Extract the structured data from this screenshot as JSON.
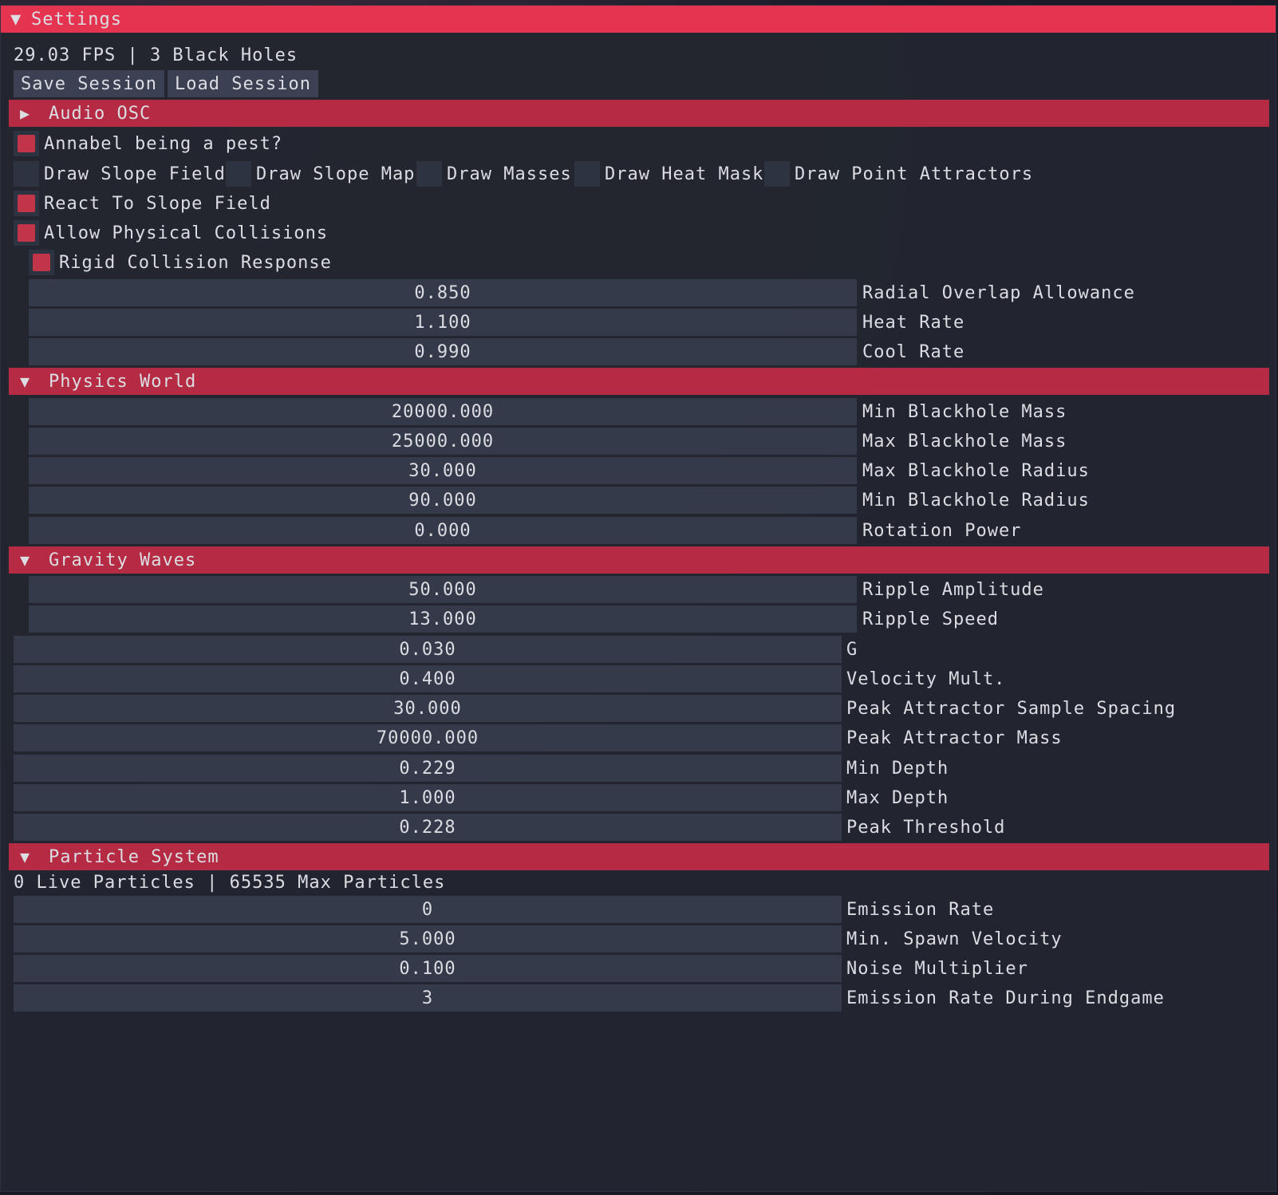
{
  "window": {
    "title": "Settings",
    "collapse_icon": "triangle-down"
  },
  "status": {
    "text": "29.03 FPS | 3 Black Holes"
  },
  "buttons": {
    "save": "Save Session",
    "load": "Load Session"
  },
  "sections": {
    "audio": {
      "label": "Audio OSC",
      "icon": "triangle-right"
    },
    "physics": {
      "label": "Physics World",
      "icon": "triangle-down"
    },
    "gravity": {
      "label": "Gravity Waves",
      "icon": "triangle-down"
    },
    "particles": {
      "label": "Particle System",
      "icon": "triangle-down"
    }
  },
  "checkboxes": {
    "annabel": {
      "label": "Annabel being a pest?",
      "checked": true
    },
    "slope_field": {
      "label": "Draw Slope Field",
      "checked": false
    },
    "slope_map": {
      "label": "Draw Slope Map",
      "checked": false
    },
    "masses": {
      "label": "Draw Masses",
      "checked": false
    },
    "heat_mask": {
      "label": "Draw Heat Mask",
      "checked": false
    },
    "point_attractors": {
      "label": "Draw Point Attractors",
      "checked": false
    },
    "react_slope": {
      "label": "React To Slope Field",
      "checked": true
    },
    "collisions": {
      "label": "Allow Physical Collisions",
      "checked": true
    },
    "rigid": {
      "label": "Rigid Collision Response",
      "checked": true
    }
  },
  "sliders": {
    "radial_overlap": {
      "value": "0.850",
      "label": "Radial Overlap Allowance"
    },
    "heat_rate": {
      "value": "1.100",
      "label": "Heat Rate"
    },
    "cool_rate": {
      "value": "0.990",
      "label": "Cool Rate"
    },
    "min_bh_mass": {
      "value": "20000.000",
      "label": "Min Blackhole Mass"
    },
    "max_bh_mass": {
      "value": "25000.000",
      "label": "Max Blackhole Mass"
    },
    "max_bh_radius": {
      "value": "30.000",
      "label": "Max Blackhole Radius"
    },
    "min_bh_radius": {
      "value": "90.000",
      "label": "Min Blackhole Radius"
    },
    "rotation_power": {
      "value": "0.000",
      "label": "Rotation Power"
    },
    "ripple_amp": {
      "value": "50.000",
      "label": "Ripple Amplitude"
    },
    "ripple_speed": {
      "value": "13.000",
      "label": "Ripple Speed"
    },
    "g": {
      "value": "0.030",
      "label": "G"
    },
    "velocity_mult": {
      "value": "0.400",
      "label": "Velocity Mult."
    },
    "peak_spacing": {
      "value": "30.000",
      "label": "Peak Attractor Sample Spacing"
    },
    "peak_mass": {
      "value": "70000.000",
      "label": "Peak Attractor Mass"
    },
    "min_depth": {
      "value": "0.229",
      "label": "Min Depth"
    },
    "max_depth": {
      "value": "1.000",
      "label": "Max Depth"
    },
    "peak_threshold": {
      "value": "0.228",
      "label": "Peak Threshold"
    },
    "emission_rate": {
      "value": "0",
      "label": "Emission Rate"
    },
    "min_spawn_vel": {
      "value": "5.000",
      "label": "Min. Spawn Velocity"
    },
    "noise_mult": {
      "value": "0.100",
      "label": "Noise Multiplier"
    },
    "emission_endgame": {
      "value": "3",
      "label": "Emission Rate During Endgame"
    }
  },
  "particles": {
    "status": "0 Live Particles | 65535 Max Particles"
  },
  "colors": {
    "title_bar": "#e43450",
    "header": "#b52b44",
    "check": "#c23447",
    "frame": "#343a4a",
    "window_bg": "#232630"
  }
}
